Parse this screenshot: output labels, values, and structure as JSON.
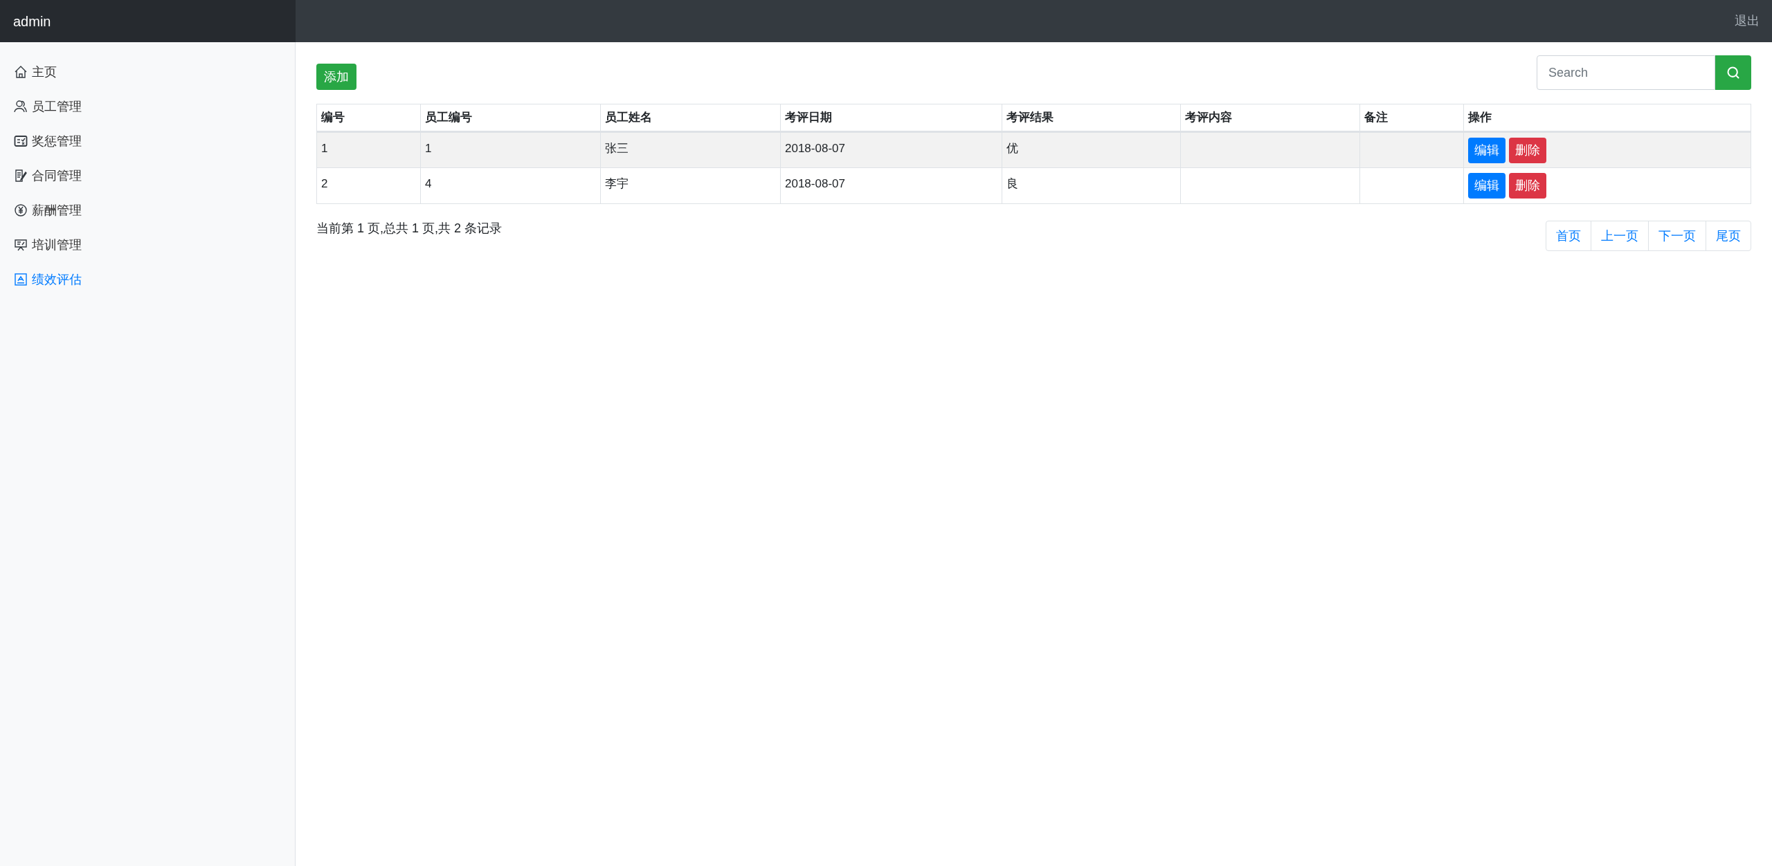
{
  "navbar": {
    "brand": "admin",
    "logout": "退出"
  },
  "sidebar": {
    "items": [
      {
        "label": "主页",
        "kind": "home",
        "selected": false
      },
      {
        "label": "员工管理",
        "kind": "users",
        "selected": false
      },
      {
        "label": "奖惩管理",
        "kind": "checklist",
        "selected": false
      },
      {
        "label": "合同管理",
        "kind": "contract",
        "selected": false
      },
      {
        "label": "薪酬管理",
        "kind": "yen",
        "selected": false
      },
      {
        "label": "培训管理",
        "kind": "board",
        "selected": false
      },
      {
        "label": "绩效评估",
        "kind": "chart",
        "selected": true
      }
    ]
  },
  "toolbar": {
    "add": "添加",
    "search": {
      "placeholder": "Search"
    }
  },
  "table": {
    "columns": [
      "编号",
      "员工编号",
      "员工姓名",
      "考评日期",
      "考评结果",
      "考评内容",
      "备注",
      "操作"
    ],
    "rows": [
      {
        "selected": true,
        "cells": [
          "1",
          "1",
          "张三",
          "2018-08-07",
          "优",
          "",
          ""
        ],
        "actions": [
          "编辑",
          "删除"
        ]
      },
      {
        "selected": false,
        "cells": [
          "2",
          "4",
          "李宇",
          "2018-08-07",
          "良",
          "",
          ""
        ],
        "actions": [
          "编辑",
          "删除"
        ]
      }
    ]
  },
  "footer": {
    "summary": "当前第 1 页,总共 1 页,共 2 条记录",
    "pages": [
      "首页",
      "上一页",
      "下一页",
      "尾页"
    ]
  }
}
